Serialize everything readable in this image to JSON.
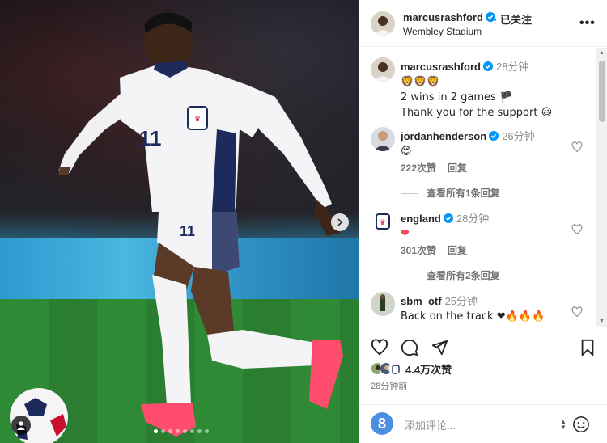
{
  "post": {
    "author": "marcusrashford",
    "follow_label": "· 已关注",
    "location": "Wembley Stadium",
    "more_label": "•••"
  },
  "comments": [
    {
      "user": "marcusrashford",
      "time": "28分钟",
      "lines": [
        "🦁🦁🦁",
        "2 wins in 2 games 🏴",
        "Thank you for the support 😃"
      ]
    },
    {
      "user": "jordanhenderson",
      "time": "26分钟",
      "lines": [
        "😍"
      ],
      "likes": "222次赞",
      "reply_label": "回复",
      "view_replies": "查看所有1条回复"
    },
    {
      "user": "england",
      "time": "28分钟",
      "lines": [
        "❤"
      ],
      "likes": "301次赞",
      "reply_label": "回复",
      "view_replies": "查看所有2条回复"
    },
    {
      "user": "sbm_otf",
      "time": "25分钟",
      "lines": [
        "Back on the track ❤🔥🔥🔥"
      ]
    }
  ],
  "stats": {
    "likes": "4.4万次赞",
    "posted": "28分钟前"
  },
  "composer": {
    "placeholder": "添加评论...",
    "avatar_letter": "8"
  },
  "colors": {
    "verified": "#0095f6",
    "text": "#262626",
    "muted": "#737373"
  }
}
